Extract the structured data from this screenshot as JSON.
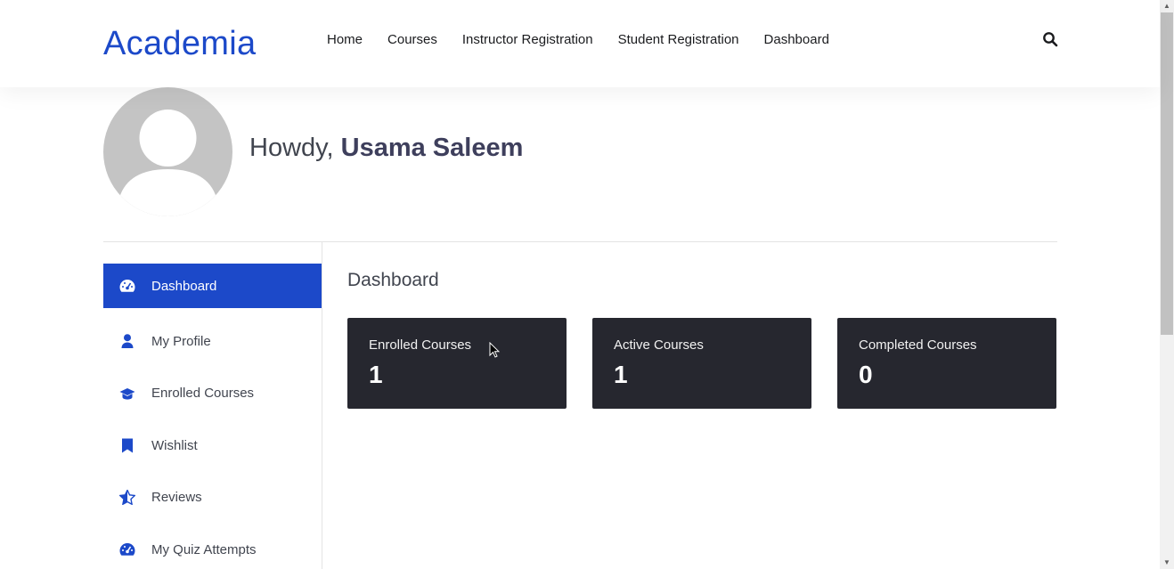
{
  "header": {
    "logo": "Academia",
    "nav": [
      "Home",
      "Courses",
      "Instructor Registration",
      "Student Registration",
      "Dashboard"
    ],
    "search_icon": "search-icon"
  },
  "profile": {
    "greeting": "Howdy,",
    "name": "Usama Saleem"
  },
  "sidebar": {
    "items": [
      {
        "label": "Dashboard",
        "icon": "dashboard-icon",
        "active": true
      },
      {
        "label": "My Profile",
        "icon": "user-icon"
      },
      {
        "label": "Enrolled Courses",
        "icon": "graduation-cap-icon"
      },
      {
        "label": "Wishlist",
        "icon": "bookmark-icon"
      },
      {
        "label": "Reviews",
        "icon": "star-half-icon"
      },
      {
        "label": "My Quiz Attempts",
        "icon": "dashboard-icon"
      }
    ]
  },
  "main": {
    "title": "Dashboard",
    "cards": [
      {
        "label": "Enrolled Courses",
        "value": "1"
      },
      {
        "label": "Active Courses",
        "value": "1"
      },
      {
        "label": "Completed Courses",
        "value": "0"
      }
    ]
  },
  "colors": {
    "accent": "#1c49c9",
    "card_bg": "#26272f"
  }
}
